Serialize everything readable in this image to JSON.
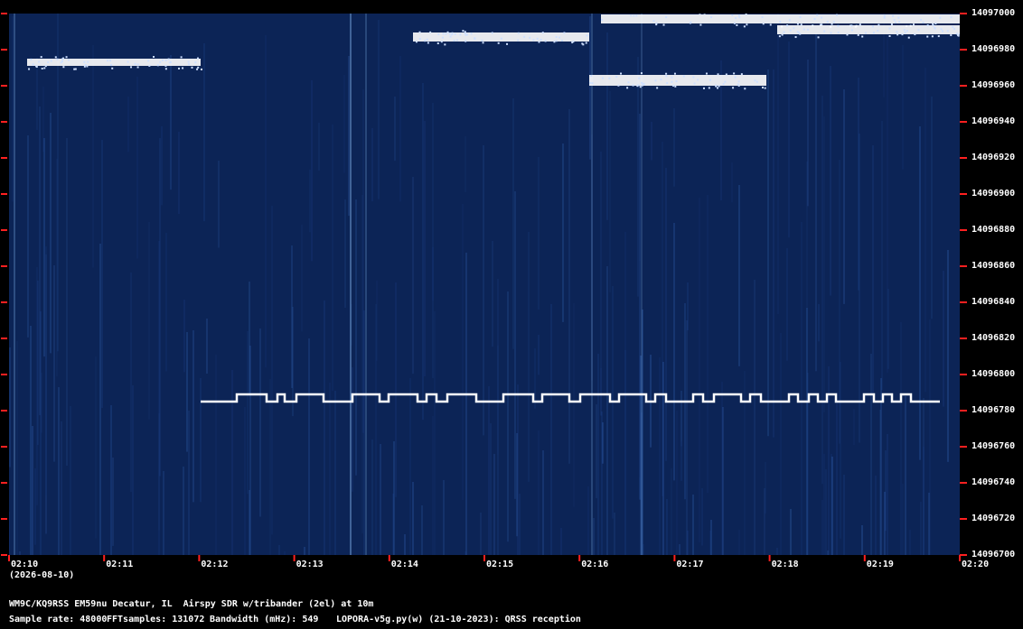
{
  "yaxis": {
    "labels": [
      "14097000",
      "14096980",
      "14096960",
      "14096940",
      "14096920",
      "14096900",
      "14096880",
      "14096860",
      "14096840",
      "14096820",
      "14096800",
      "14096780",
      "14096760",
      "14096740",
      "14096720",
      "14096700"
    ]
  },
  "xaxis": {
    "labels": [
      "02:10",
      "02:11",
      "02:12",
      "02:13",
      "02:14",
      "02:15",
      "02:16",
      "02:17",
      "02:18",
      "02:19",
      "02:20"
    ],
    "date": "(2026-08-10)"
  },
  "footer": {
    "line1": "WM9C/KQ9RSS EM59nu Decatur, IL  Airspy SDR w/tribander (2el) at 10m",
    "sample_rate": "Sample rate: 48000",
    "fft_samples": "FFTsamples: 131072",
    "bandwidth": "Bandwidth (mHz): 549",
    "software": "LOPORA-v5g.py(w) (21-10-2023): QRSS reception"
  },
  "colors": {
    "background": "#000000",
    "waterfall": "#0c2456",
    "tick": "#ff2020",
    "signal": "#ffffff"
  }
}
